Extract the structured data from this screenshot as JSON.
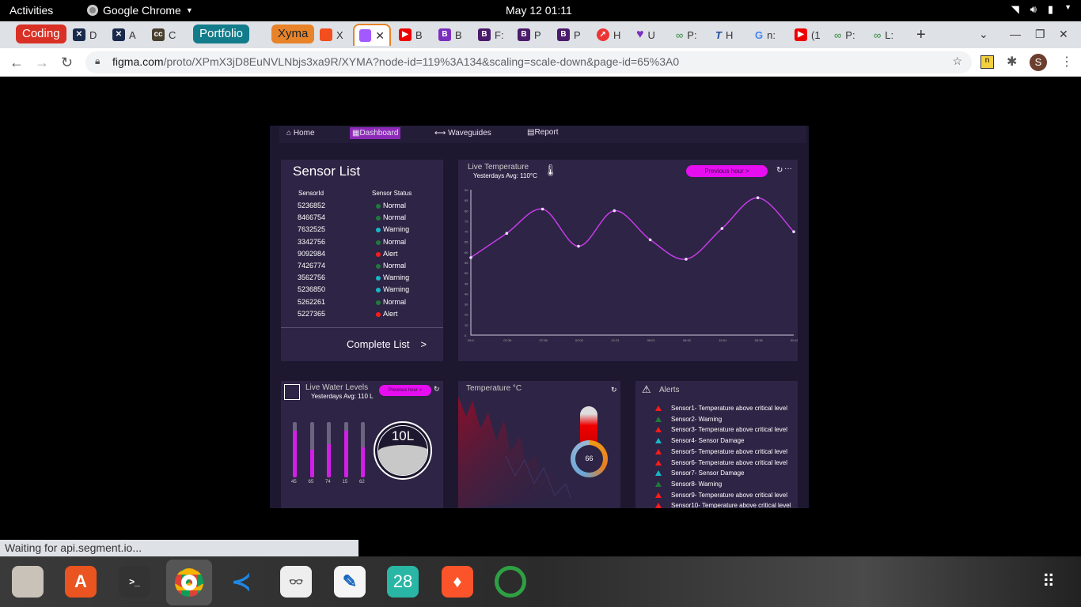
{
  "topbar": {
    "activities": "Activities",
    "app_name": "Google Chrome",
    "clock": "May 12  01:11"
  },
  "tabs": {
    "group_coding": "Coding",
    "tab_d": "D",
    "tab_a": "A",
    "tab_c": "C",
    "group_portfolio": "Portfolio",
    "group_xyma": "Xyma",
    "tab_x1": "X",
    "tab_b1": "B",
    "tab_b2": "B",
    "tab_f": "F:",
    "tab_p1": "P",
    "tab_p2": "P",
    "tab_h": "H",
    "tab_u": "U",
    "tab_p3": "P:",
    "tab_h2": "H",
    "tab_n": "n:",
    "tab_1": "(1",
    "tab_p4": "P:",
    "tab_l": "L:",
    "new_tab": "+"
  },
  "omnibox": {
    "domain": "figma.com",
    "path": "/proto/XPmX3jD8EuNVLNbjs3xa9R/XYMA?node-id=119%3A134&scaling=scale-down&page-id=65%3A0"
  },
  "profile_initial": "S",
  "status": "Waiting for api.segment.io...",
  "dashboard": {
    "nav": {
      "home": "Home",
      "dashboard": "Dashboard",
      "waveguides": "Waveguides",
      "report": "Report"
    },
    "sensor_list": {
      "title": "Sensor List",
      "col_id": "SensorId",
      "col_status": "Sensor Status",
      "rows": [
        {
          "id": "5236852",
          "status": "Normal",
          "color": "#1f7a3a"
        },
        {
          "id": "8466754",
          "status": "Normal",
          "color": "#1f7a3a"
        },
        {
          "id": "7632525",
          "status": "Warning",
          "color": "#16b8c8"
        },
        {
          "id": "3342756",
          "status": "Normal",
          "color": "#1f7a3a"
        },
        {
          "id": "9092984",
          "status": "Alert",
          "color": "#ff1a1a"
        },
        {
          "id": "7426774",
          "status": "Normal",
          "color": "#1f7a3a"
        },
        {
          "id": "3562756",
          "status": "Warning",
          "color": "#16b8c8"
        },
        {
          "id": "5236850",
          "status": "Warning",
          "color": "#16b8c8"
        },
        {
          "id": "5262261",
          "status": "Normal",
          "color": "#1f7a3a"
        },
        {
          "id": "5227365",
          "status": "Alert",
          "color": "#ff1a1a"
        }
      ],
      "complete_list": "Complete List",
      "arrow": ">"
    },
    "live_temp": {
      "title": "Live Temperature",
      "subtitle": "Yesterdays Avg: 110°C",
      "button": "Previous hour  >",
      "more": "···"
    },
    "water": {
      "title": "Live Water Levels",
      "subtitle": "Yesterdays Avg: 110 L",
      "button": "Previous hour  >",
      "gauge": "10L",
      "bars": [
        {
          "label": "45",
          "level": 0.85
        },
        {
          "label": "65",
          "level": 0.5
        },
        {
          "label": "74",
          "level": 0.6
        },
        {
          "label": "15",
          "level": 0.85
        },
        {
          "label": "62",
          "level": 0.55
        }
      ]
    },
    "temperature": {
      "title": "Temperature °C",
      "value": "66"
    },
    "alerts": {
      "title": "Alerts",
      "items": [
        {
          "text": "Sensor1- Temperature above critical level",
          "color": "#ff1a1a"
        },
        {
          "text": "Sensor2- Warning",
          "color": "#1f7a3a"
        },
        {
          "text": "Sensor3- Temperature above critical level",
          "color": "#ff1a1a"
        },
        {
          "text": "Sensor4- Sensor Damage",
          "color": "#16b8c8"
        },
        {
          "text": "Sensor5- Temperature above critical level",
          "color": "#ff1a1a"
        },
        {
          "text": "Sensor6- Temperature above critical level",
          "color": "#ff1a1a"
        },
        {
          "text": "Sensor7- Sensor Damage",
          "color": "#16b8c8"
        },
        {
          "text": "Sensor8- Warning",
          "color": "#1f7a3a"
        },
        {
          "text": "Sensor9- Temperature above critical level",
          "color": "#ff1a1a"
        },
        {
          "text": "Sensor10- Temperature above critical level",
          "color": "#ff1a1a"
        }
      ]
    }
  },
  "dock": {
    "calendar_day": "28"
  },
  "chart_data": {
    "type": "line",
    "x": [
      "05:4",
      "02:30",
      "07:38",
      "02:02",
      "12:23",
      "05:01",
      "06:32",
      "10:01",
      "05:36",
      "00:41"
    ],
    "values": [
      48,
      63,
      78,
      55,
      77,
      59,
      47,
      66,
      85,
      64
    ],
    "ylim": [
      0,
      90
    ],
    "yticks": [
      "0",
      "10",
      "20",
      "30",
      "40",
      "45",
      "50",
      "55",
      "60",
      "65",
      "70",
      "75",
      "80",
      "85",
      "90"
    ],
    "color": "#c63be8",
    "grid": false
  }
}
